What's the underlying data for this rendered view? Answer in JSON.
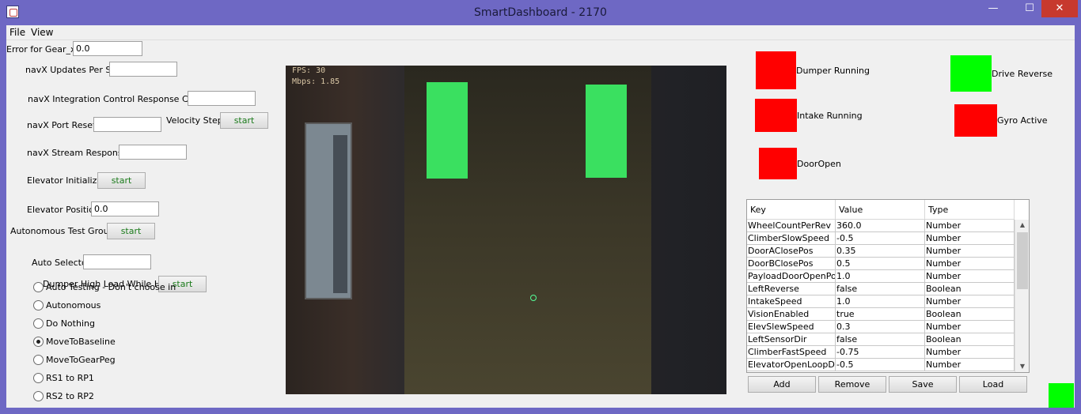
{
  "window": {
    "title": "SmartDashboard - 2170",
    "min": "—",
    "max": "☐",
    "close": "✕"
  },
  "menu": {
    "file": "File",
    "view": "View"
  },
  "widgets": {
    "error_gear": {
      "label": "Error for Gear_x:",
      "value": "0.0"
    },
    "navx_updates": {
      "label": "navX Updates Per Sec",
      "value": ""
    },
    "navx_integration": {
      "label": "navX Integration Control Response Count",
      "value": ""
    },
    "navx_port_resets": {
      "label": "navX Port Resets",
      "value": ""
    },
    "velocity_step": {
      "label": "Velocity Step",
      "button": "start"
    },
    "navx_stream": {
      "label": "navX Stream Responses",
      "value": ""
    },
    "elevator_init": {
      "label": "Elevator Initialize",
      "button": "start"
    },
    "elevator_pos": {
      "label": "Elevator Position",
      "value": "0.0"
    },
    "auto_test_group": {
      "label": "Autonomous Test Group",
      "button": "start"
    },
    "auto_selector": {
      "label": "Auto Selector",
      "value": ""
    },
    "dumper_high": {
      "label": "Dumper High Load While Held",
      "button": "start"
    }
  },
  "auto_options": [
    {
      "label": "Auto Testing - Don't choose in",
      "selected": false
    },
    {
      "label": "Autonomous",
      "selected": false
    },
    {
      "label": "Do Nothing",
      "selected": false
    },
    {
      "label": "MoveToBaseline",
      "selected": true
    },
    {
      "label": "MoveToGearPeg",
      "selected": false
    },
    {
      "label": "RS1 to RP1",
      "selected": false
    },
    {
      "label": "RS2 to RP2",
      "selected": false
    }
  ],
  "camera": {
    "fps": "FPS: 30",
    "mbps": "Mbps: 1.85"
  },
  "indicators": {
    "dumper_running": {
      "label": "Dumper Running",
      "color": "#ff0000"
    },
    "intake_running": {
      "label": "Intake Running",
      "color": "#ff0000"
    },
    "door_open": {
      "label": "DoorOpen",
      "color": "#ff0000"
    },
    "drive_reverse": {
      "label": "Drive Reverse",
      "color": "#00ff00"
    },
    "gyro_active": {
      "label": "Gyro Active",
      "color": "#ff0000"
    },
    "corner_status": {
      "color": "#00ff00"
    }
  },
  "preferences": {
    "headers": [
      "Key",
      "Value",
      "Type"
    ],
    "rows": [
      [
        "WheelCountPerRev",
        "360.0",
        "Number"
      ],
      [
        "ClimberSlowSpeed",
        "-0.5",
        "Number"
      ],
      [
        "DoorAClosePos",
        "0.35",
        "Number"
      ],
      [
        "DoorBClosePos",
        "0.5",
        "Number"
      ],
      [
        "PayloadDoorOpenPos",
        "1.0",
        "Number"
      ],
      [
        "LeftReverse",
        "false",
        "Boolean"
      ],
      [
        "IntakeSpeed",
        "1.0",
        "Number"
      ],
      [
        "VisionEnabled",
        "true",
        "Boolean"
      ],
      [
        "ElevSlewSpeed",
        "0.3",
        "Number"
      ],
      [
        "LeftSensorDir",
        "false",
        "Boolean"
      ],
      [
        "ClimberFastSpeed",
        "-0.75",
        "Number"
      ],
      [
        "ElevatorOpenLoopDn",
        "-0.5",
        "Number"
      ]
    ],
    "buttons": {
      "add": "Add",
      "remove": "Remove",
      "save": "Save",
      "load": "Load"
    }
  }
}
